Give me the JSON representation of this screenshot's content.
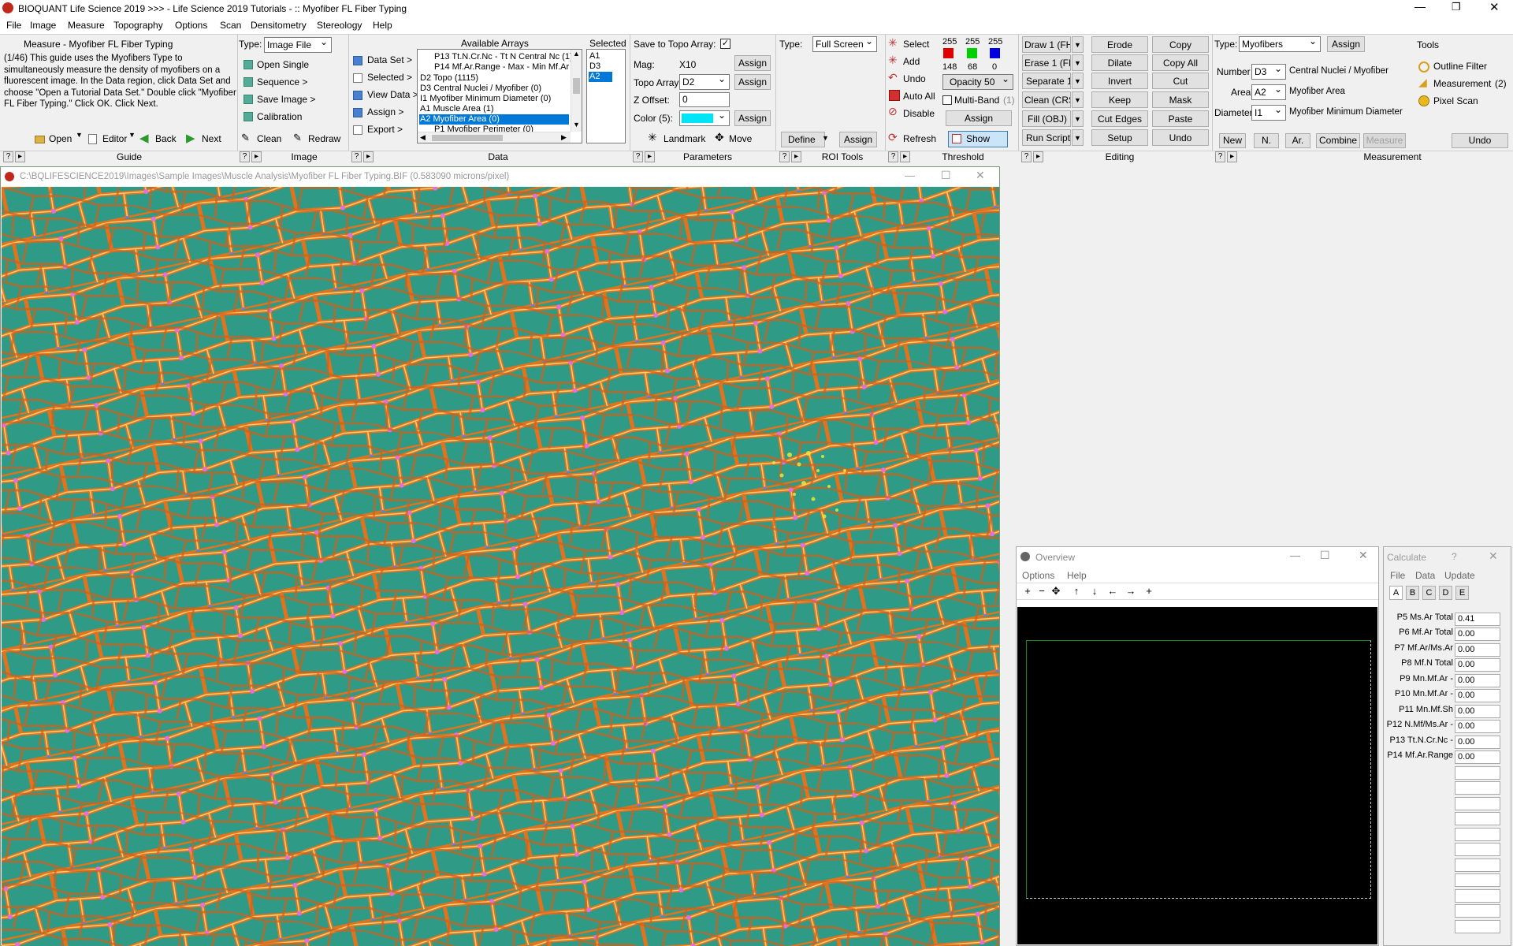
{
  "app": {
    "title": "BIOQUANT Life Science 2019 >>> - Life Science 2019 Tutorials - :: Myofiber FL Fiber Typing"
  },
  "menu": [
    "File",
    "Image",
    "Measure",
    "Topography",
    "Options",
    "Scan",
    "Densitometry",
    "Stereology",
    "Help"
  ],
  "guide": {
    "title": "Measure - Myofiber FL Fiber Typing",
    "text": "(1/46) This guide uses the Myofibers Type to simultaneously measure the density of myofibers on a fluorescent image. In the Data region, click Data Set and choose \"Open a Tutorial Data Set.\" Double click \"Myofiber FL Fiber Typing.\" Click OK. Click Next.",
    "open": "Open",
    "editor": "Editor",
    "back": "Back",
    "next": "Next",
    "section": "Guide"
  },
  "image": {
    "type_label": "Type:",
    "type_value": "Image File",
    "open_single": "Open Single",
    "sequence": "Sequence >",
    "save_image": "Save Image >",
    "calibration": "Calibration",
    "clean": "Clean",
    "redraw": "Redraw",
    "section": "Image"
  },
  "data": {
    "data_set": "Data Set >",
    "selected": "Selected >",
    "view_data": "View Data >",
    "assign": "Assign >",
    "export": "Export >",
    "available_header": "Available Arrays",
    "available": [
      "P13 Tt.N.Cr.Nc - Tt N Central Nc (1)",
      "P14 Mf.Ar.Range - Max - Min Mf.Ar (",
      "D2 Topo (1115)",
      "D3 Central Nuclei / Myofiber (0)",
      "I1 Myofiber Minimum Diameter (0)",
      "A1 Muscle Area (1)",
      "A2 Myofiber Area (0)",
      "P1 Myofiber Perimeter (0)"
    ],
    "selected_index": 6,
    "selected_header": "Selected",
    "selected_items": [
      "A1",
      "D3",
      "A2"
    ],
    "section": "Data"
  },
  "parameters": {
    "save_topo": "Save to Topo Array:",
    "mag_label": "Mag:",
    "mag_value": "X10",
    "topo_label": "Topo Array:",
    "topo_value": "D2",
    "zoffset_label": "Z Offset:",
    "zoffset_value": "0",
    "color_label": "Color (5):",
    "assign": "Assign",
    "landmark": "Landmark",
    "move": "Move",
    "section": "Parameters"
  },
  "roi": {
    "type_label": "Type:",
    "type_value": "Full Screen",
    "define": "Define",
    "assign": "Assign",
    "section": "ROI Tools"
  },
  "threshold": {
    "select": "Select",
    "add": "Add",
    "undo": "Undo",
    "auto_all": "Auto All",
    "disable": "Disable",
    "rgb_top": [
      "255",
      "255",
      "255"
    ],
    "rgb_bottom": [
      "148",
      "68",
      "0"
    ],
    "opacity": "Opacity 50",
    "multiband": "Multi-Band",
    "multiband_count": "(1)",
    "assign": "Assign",
    "refresh": "Refresh",
    "show": "Show",
    "section": "Threshold"
  },
  "editing": {
    "draw": "Draw 1 (FH)",
    "erase": "Erase 1 (FH)",
    "separate": "Separate 1",
    "clean": "Clean (CRS)",
    "fill": "Fill (OBJ)",
    "run_script": "Run Script",
    "erode": "Erode",
    "dilate": "Dilate",
    "invert": "Invert",
    "keep": "Keep",
    "cut_edges": "Cut Edges",
    "setup": "Setup",
    "copy": "Copy",
    "copy_all": "Copy All",
    "cut": "Cut",
    "mask": "Mask",
    "paste": "Paste",
    "undo": "Undo",
    "section": "Editing"
  },
  "measurement": {
    "type_label": "Type:",
    "type_value": "Myofibers",
    "assign": "Assign",
    "number_label": "Number",
    "number_value": "D3",
    "number_desc": "Central Nuclei / Myofiber",
    "area_label": "Area",
    "area_value": "A2",
    "area_desc": "Myofiber Area",
    "diameter_label": "Diameter",
    "diameter_value": "I1",
    "diameter_desc": "Myofiber Minimum Diameter",
    "new": "New",
    "n": "N.",
    "ar": "Ar.",
    "combine": "Combine",
    "measure": "Measure",
    "undo": "Undo",
    "section": "Measurement"
  },
  "tools": {
    "header": "Tools",
    "outline": "Outline Filter",
    "measurement": "Measurement",
    "measurement_count": "(2)",
    "pixel_scan": "Pixel Scan"
  },
  "image_window": {
    "title": "C:\\BQLIFESCIENCE2019\\Images\\Sample Images\\Muscle Analysis\\Myofiber FL Fiber Typing.BIF (0.583090 microns/pixel)"
  },
  "overview": {
    "title": "Overview",
    "menu": [
      "Options",
      "Help"
    ],
    "tools": [
      "+",
      "−",
      "✥",
      "↑",
      "↓",
      "←",
      "→",
      "+"
    ]
  },
  "calculate": {
    "title": "Calculate",
    "help": "?",
    "menu": [
      "File",
      "Data",
      "Update"
    ],
    "tabs": [
      "A",
      "B",
      "C",
      "D",
      "E"
    ],
    "params": [
      {
        "label": "P5 Ms.Ar Total",
        "value": "0.41"
      },
      {
        "label": "P6 Mf.Ar Total",
        "value": "0.00"
      },
      {
        "label": "P7 Mf.Ar/Ms.Ar",
        "value": "0.00"
      },
      {
        "label": "P8 Mf.N Total",
        "value": "0.00"
      },
      {
        "label": "P9 Mn.Mf.Ar -",
        "value": "0.00"
      },
      {
        "label": "P10 Mn.Mf.Ar -",
        "value": "0.00"
      },
      {
        "label": "P11 Mn.Mf.Sh",
        "value": "0.00"
      },
      {
        "label": "P12 N.Mf/Ms.Ar -",
        "value": "0.00"
      },
      {
        "label": "P13 Tt.N.Cr.Nc -",
        "value": "0.00"
      },
      {
        "label": "P14 Mf.Ar.Range",
        "value": "0.00"
      }
    ]
  },
  "colors": {
    "threshold_r": "#e00000",
    "threshold_g": "#00d000",
    "threshold_b": "#0000e0",
    "param_color": "#00e5f5",
    "fiber_bg": "#2f9a86",
    "membrane": "#e2731c"
  }
}
